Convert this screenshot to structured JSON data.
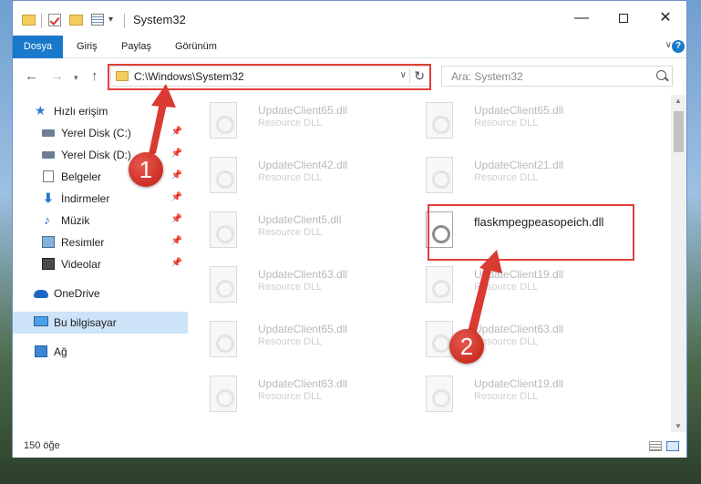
{
  "window": {
    "title": "System32",
    "minimize_glyph": "—",
    "close_glyph": "✕"
  },
  "ribbon": {
    "tabs": [
      "Dosya",
      "Giriş",
      "Paylaş",
      "Görünüm"
    ],
    "expand_glyph": "∨",
    "help_glyph": "?"
  },
  "navigation": {
    "back_glyph": "←",
    "forward_glyph": "→",
    "recent_glyph": "▾",
    "up_glyph": "↑",
    "address": "C:\\Windows\\System32",
    "address_dropdown_glyph": "∨",
    "refresh_glyph": "↻",
    "search_placeholder": "Ara: System32"
  },
  "sidebar": {
    "items": [
      {
        "label": "Hızlı erişim",
        "icon": "star-icon"
      },
      {
        "label": "Yerel Disk (C:)",
        "icon": "drive-icon",
        "pinned": true
      },
      {
        "label": "Yerel Disk (D:)",
        "icon": "drive-icon",
        "pinned": true
      },
      {
        "label": "Belgeler",
        "icon": "documents-icon",
        "pinned": true
      },
      {
        "label": "İndirmeler",
        "icon": "download-icon",
        "pinned": true
      },
      {
        "label": "Müzik",
        "icon": "music-icon",
        "pinned": true
      },
      {
        "label": "Resimler",
        "icon": "pictures-icon",
        "pinned": true
      },
      {
        "label": "Videolar",
        "icon": "videos-icon",
        "pinned": true
      },
      {
        "label": "OneDrive",
        "icon": "onedrive-icon"
      },
      {
        "label": "Bu bilgisayar",
        "icon": "this-pc-icon",
        "selected": true
      },
      {
        "label": "Ağ",
        "icon": "network-icon"
      }
    ],
    "pin_glyph": "📌"
  },
  "files": [
    {
      "name": "UpdateClient65.dll",
      "type": "Resource DLL"
    },
    {
      "name": "UpdateClient65.dll",
      "type": "Resource DLL"
    },
    {
      "name": "UpdateClient42.dll",
      "type": "Resource DLL"
    },
    {
      "name": "UpdateClient21.dll",
      "type": "Resource DLL"
    },
    {
      "name": "UpdateClient5.dll",
      "type": "Resource DLL"
    },
    {
      "name": "flaskmpegpeasopeich.dll",
      "type": "",
      "selected": true
    },
    {
      "name": "UpdateClient63.dll",
      "type": "Resource DLL"
    },
    {
      "name": "UpdateClient19.dll",
      "type": "Resource DLL"
    },
    {
      "name": "UpdateClient65.dll",
      "type": "Resource DLL"
    },
    {
      "name": "UpdateClient63.dll",
      "type": "Resource DLL"
    },
    {
      "name": "UpdateClient63.dll",
      "type": "Resource DLL"
    },
    {
      "name": "UpdateClient19.dll",
      "type": "Resource DLL"
    }
  ],
  "status": {
    "item_count": "150 öğe"
  },
  "annotations": {
    "marker_1": "1",
    "marker_2": "2",
    "color": "#e0403a"
  }
}
